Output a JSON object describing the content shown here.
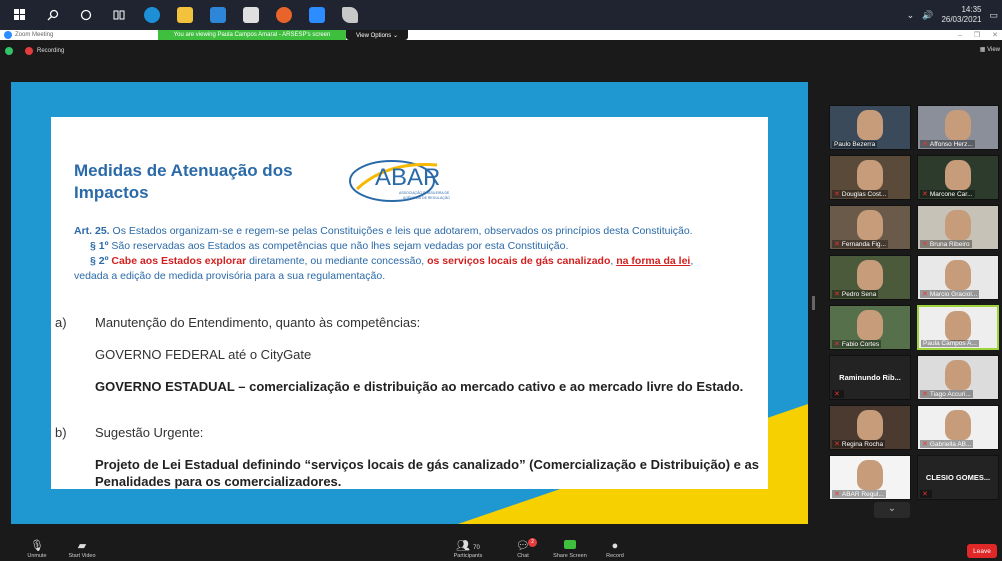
{
  "taskbar": {
    "icons": [
      "windows-icon",
      "search-icon",
      "cortana-icon",
      "task-view-icon",
      "chrome-icon",
      "file-explorer-icon",
      "mail-icon",
      "store-icon",
      "firefox-icon",
      "zoom-icon",
      "paint-icon"
    ],
    "time": "14:35",
    "date": "26/03/2021"
  },
  "zoom": {
    "window_title": "Zoom Meeting",
    "share_banner": "You are viewing Paula Campos Amaral - ARSESP's screen",
    "view_options": "View Options ⌄",
    "recording": "Recording",
    "view": "View"
  },
  "slide": {
    "title": "Medidas de Atenuação dos Impactos",
    "logo_text": "ABAR",
    "logo_sub1": "ASSOCIAÇÃO BRASILEIRA DE",
    "logo_sub2": "AGÊNCIAS DE REGULAÇÃO",
    "art_label": "Art. 25.",
    "art_text": " Os Estados organizam-se e regem-se pelas Constituições e leis que adotarem, observados os princípios desta Constituição.",
    "p1_label": "§ 1º",
    "p1_text": " São reservadas aos Estados as competências que não lhes sejam vedadas por esta Constituição.",
    "p2_label": "§ 2º",
    "p2_red": "Cabe aos Estados explorar",
    "p2_mid": " diretamente, ou mediante concessão, ",
    "p2_red2": "os serviços locais de gás canalizado",
    "p2_comma": ", ",
    "p2_underline": "na forma da lei",
    "p2_end": ",",
    "p2_tail": "vedada a edição de medida provisória para a sua regulamentação.",
    "a_label": "a)",
    "a_text": "Manutenção do Entendimento, quanto às competências:",
    "federal": "GOVERNO FEDERAL até o CityGate",
    "estadual": "GOVERNO ESTADUAL – comercialização e distribuição ao mercado cativo e ao mercado livre do Estado.",
    "b_label": "b)",
    "b_text": "Sugestão Urgente:",
    "projeto": "Projeto de Lei Estadual definindo “serviços locais de gás canalizado” (Comercialização e Distribuição) e as Penalidades para os comercializadores."
  },
  "participants": [
    {
      "name": "Paulo Bezerra",
      "muted": false,
      "video": true,
      "bg": "#3a4a5a"
    },
    {
      "name": "Affonso Herz...",
      "muted": true,
      "video": true,
      "bg": "#8a8f99"
    },
    {
      "name": "Douglas Cost...",
      "muted": true,
      "video": true,
      "bg": "#5a4a3a"
    },
    {
      "name": "Marcone Car...",
      "muted": true,
      "video": true,
      "bg": "#2d3b2d"
    },
    {
      "name": "Fernanda Fig...",
      "muted": true,
      "video": true,
      "bg": "#6a5a4a"
    },
    {
      "name": "Bruna Ribeiro",
      "muted": true,
      "video": true,
      "bg": "#c7c2b8"
    },
    {
      "name": "Pedro Sena",
      "muted": true,
      "video": true,
      "bg": "#4a5a3a"
    },
    {
      "name": "Marcio Graciol...",
      "muted": true,
      "video": true,
      "bg": "#e8e8e8"
    },
    {
      "name": "Fabio Cortes",
      "muted": true,
      "video": true,
      "bg": "#55704a"
    },
    {
      "name": "Paula Campos A...",
      "muted": false,
      "video": true,
      "bg": "#eeeeee",
      "active": true
    },
    {
      "name": "Raminundo Rib...",
      "muted": true,
      "video": false
    },
    {
      "name": "Tiago Accuri...",
      "muted": true,
      "video": true,
      "bg": "#dcdcdc"
    },
    {
      "name": "Regina Rocha",
      "muted": true,
      "video": true,
      "bg": "#4a3a30"
    },
    {
      "name": "Gabriella AB...",
      "muted": true,
      "video": true,
      "bg": "#f0f0f0"
    },
    {
      "name": "ABAR Regul...",
      "muted": true,
      "video": true,
      "bg": "#f4f4f4"
    },
    {
      "name": "CLESIO GOMES...",
      "muted": true,
      "video": false
    }
  ],
  "toolbar": {
    "unmute": "Unmute",
    "start_video": "Start Video",
    "participants": "Participants",
    "participants_count": "70",
    "chat": "Chat",
    "chat_badge": "2",
    "share_screen": "Share Screen",
    "record": "Record",
    "leave": "Leave"
  },
  "colors": {
    "slide_blue": "#2b6aa8",
    "accent_red": "#d21f1f",
    "frame_blue": "#1f98d2",
    "frame_yellow": "#f6d000",
    "banner_green": "#3ebf3e"
  }
}
